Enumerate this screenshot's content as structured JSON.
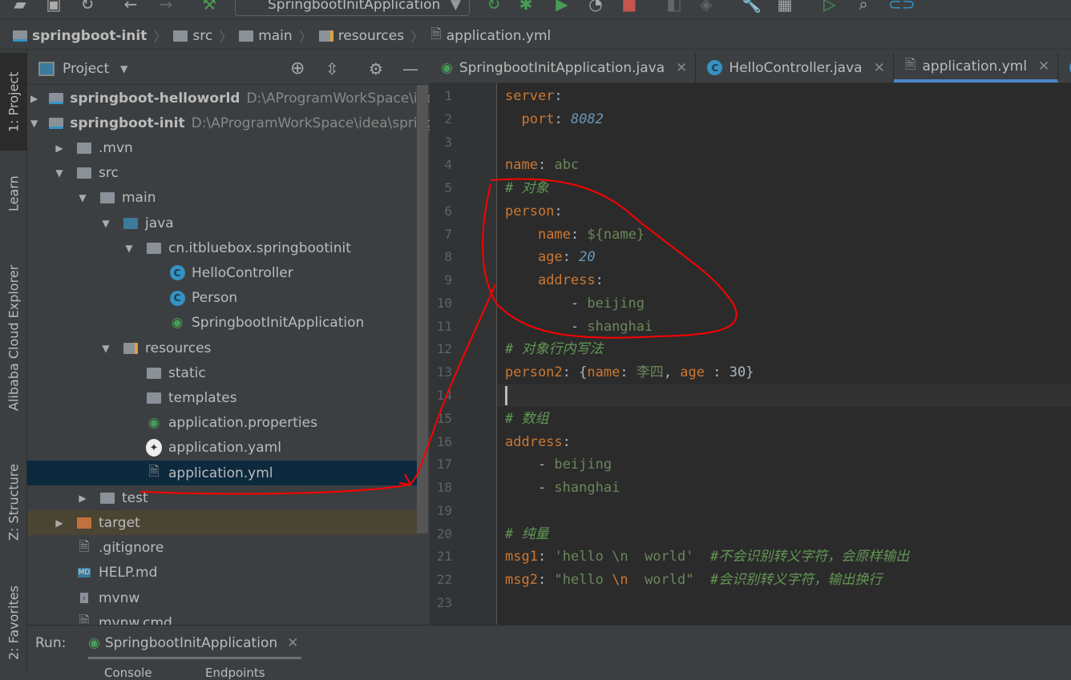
{
  "toolbar": {
    "run_config": "SpringbootInitApplication"
  },
  "breadcrumb": [
    "springboot-init",
    "src",
    "main",
    "resources",
    "application.yml"
  ],
  "side_tabs": {
    "project": "1: Project",
    "learn": "Learn",
    "cloud": "Alibaba Cloud Explorer",
    "structure": "Z: Structure",
    "favorites": "2: Favorites"
  },
  "project_panel": {
    "title": "Project",
    "tree": [
      {
        "label": "springboot-helloworld",
        "path": "D:\\AProgramWorkSpace\\idea\\",
        "bold": true
      },
      {
        "label": "springboot-init",
        "path": "D:\\AProgramWorkSpace\\idea\\springb",
        "bold": true
      },
      {
        "label": ".mvn"
      },
      {
        "label": "src"
      },
      {
        "label": "main"
      },
      {
        "label": "java"
      },
      {
        "label": "cn.itbluebox.springbootinit"
      },
      {
        "label": "HelloController"
      },
      {
        "label": "Person"
      },
      {
        "label": "SpringbootInitApplication"
      },
      {
        "label": "resources"
      },
      {
        "label": "static"
      },
      {
        "label": "templates"
      },
      {
        "label": "application.properties"
      },
      {
        "label": "application.yaml"
      },
      {
        "label": "application.yml"
      },
      {
        "label": "test"
      },
      {
        "label": "target"
      },
      {
        "label": ".gitignore"
      },
      {
        "label": "HELP.md"
      },
      {
        "label": "mvnw"
      },
      {
        "label": "mvnw.cmd"
      }
    ]
  },
  "editor_tabs": [
    {
      "label": "SpringbootInitApplication.java"
    },
    {
      "label": "HelloController.java"
    },
    {
      "label": "application.yml",
      "active": true
    }
  ],
  "code": [
    "server:",
    "  port: 8082",
    "",
    "name: abc",
    "# 对象",
    "person:",
    "    name: ${name}",
    "    age: 20",
    "    address:",
    "        - beijing",
    "        - shanghai",
    "# 对象行内写法",
    "person2: {name: 李四, age : 30}",
    "",
    "# 数组",
    "address:",
    "    - beijing",
    "    - shanghai",
    "",
    "# 纯量",
    "msg1: 'hello \\n  world'  #不会识别转义字符，会原样输出",
    "msg2: \"hello \\n  world\"  #会识别转义字符，输出换行",
    ""
  ],
  "run_panel": {
    "label": "Run:",
    "tab": "SpringbootInitApplication",
    "subtabs": [
      "Console",
      "Endpoints"
    ]
  },
  "colors": {
    "annotation": "#ff0000",
    "accent": "#4a88c7"
  }
}
